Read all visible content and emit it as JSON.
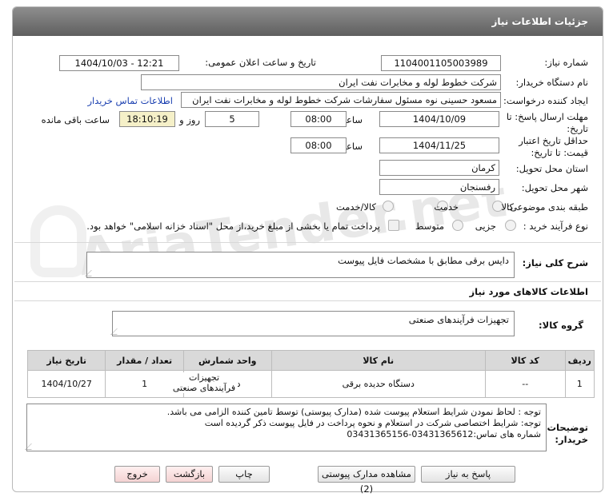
{
  "header": {
    "title": "جزئیات اطلاعات نیاز"
  },
  "form": {
    "need_number_label": "شماره نیاز:",
    "need_number": "1104001105003989",
    "announce_label": "تاریخ و ساعت اعلان عمومی:",
    "announce_value": "1404/10/03 - 12:21",
    "buyer_org_label": "نام دستگاه خریدار:",
    "buyer_org": "شرکت خطوط لوله و مخابرات نفت ایران",
    "creator_label": "ایجاد کننده درخواست:",
    "creator": "مسعود حسینی نوه  مسئول سفارشات  شرکت خطوط لوله و مخابرات نفت ایران",
    "contact_link": "اطلاعات تماس خریدار",
    "deadline_label": "مهلت ارسال پاسخ: تا تاریخ:",
    "deadline_date": "1404/10/09",
    "time_label": "ساعت",
    "deadline_time": "08:00",
    "days_value": "5",
    "days_label": "روز و",
    "remaining_time": "18:10:19",
    "remaining_label": "ساعت باقی مانده",
    "validity_label": "حداقل تاریخ اعتبار قیمت: تا تاریخ:",
    "validity_date": "1404/11/25",
    "validity_time": "08:00",
    "province_label": "استان محل تحویل:",
    "province": "کرمان",
    "city_label": "شهر محل تحویل:",
    "city": "رفسنجان",
    "category_label": "طبقه بندی موضوعی:",
    "category_options": [
      "کالا",
      "خدمت",
      "کالا/خدمت"
    ],
    "process_label": "نوع فرآیند خرید :",
    "process_options": [
      "جزیی",
      "متوسط"
    ],
    "process_note": "پرداخت تمام یا بخشی از مبلغ خرید،از محل \"اسناد خزانه اسلامی\" خواهد بود."
  },
  "description": {
    "label": "شرح کلی نیاز:",
    "text": "دایس برقی مطابق با مشخصات فایل پیوست"
  },
  "goods": {
    "section_title": "اطلاعات کالاهای مورد نیاز",
    "group_label": "گروه کالا:",
    "group_value": "تجهیزات فرآیندهای صنعتی"
  },
  "table": {
    "headers": [
      "ردیف",
      "کد کالا",
      "نام کالا",
      "واحد شمارش",
      "تعداد / مقدار",
      "تاریخ نیاز"
    ],
    "rows": [
      {
        "row": "1",
        "code": "--",
        "name": "دستگاه حدیده برقی",
        "unit": "دستگاه",
        "qty": "1",
        "date": "1404/10/27",
        "extra": "تجهیزات فرآیندهای صنعتی"
      }
    ]
  },
  "notes": {
    "label": "توضیحات خریدار:",
    "lines": [
      "توجه : لحاظ نمودن شرایط استعلام پیوست شده (مدارک پیوستی) توسط تامین کننده الزامی می باشد.",
      "توجه: شرایط اختصاصی شرکت در استعلام و نحوه پرداخت در فایل پیوست ذکر گردیده است",
      "شماره های تماس:03431365612-03431365156"
    ]
  },
  "buttons": {
    "reply": "پاسخ به نیاز",
    "attachments": "مشاهده مدارک پیوستی (2)",
    "print": "چاپ",
    "back": "بازگشت",
    "exit": "خروج"
  },
  "watermark": "AriaTender.net"
}
